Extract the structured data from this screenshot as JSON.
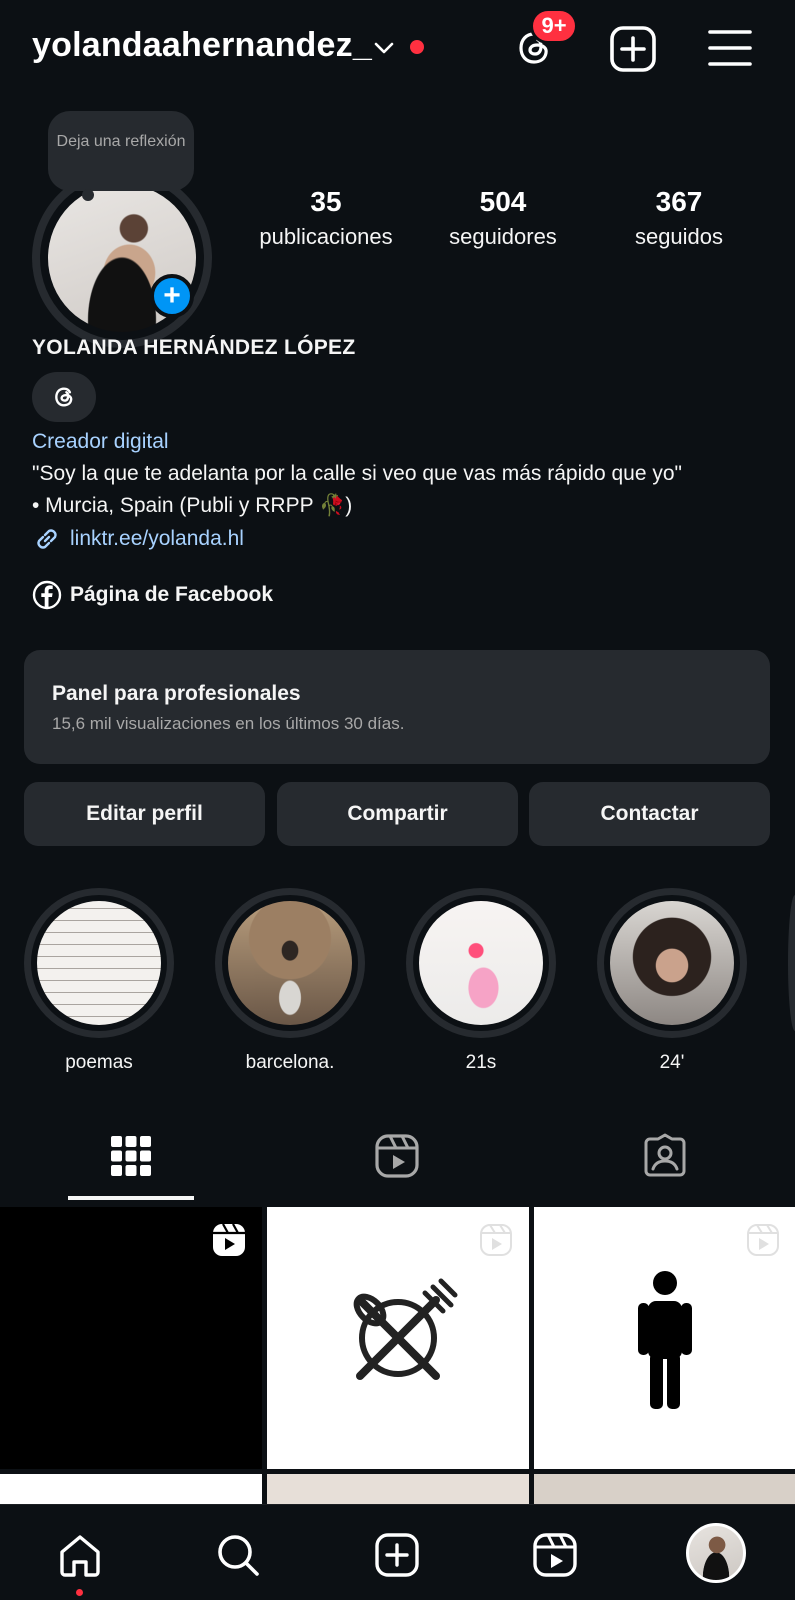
{
  "header": {
    "username": "yolandaahernandez_",
    "notification_badge": "9+"
  },
  "profile": {
    "note": "Deja una reflexión",
    "stats": [
      {
        "value": "35",
        "label": "publicaciones"
      },
      {
        "value": "504",
        "label": "seguidores"
      },
      {
        "value": "367",
        "label": "seguidos"
      }
    ],
    "full_name": "YOLANDA HERNÁNDEZ LÓPEZ",
    "category": "Creador digital",
    "bio_line1": "\"Soy la que te adelanta por la calle si veo que vas más rápido que yo\"",
    "bio_line2": "• Murcia, Spain (Publi y RRPP 🥀)",
    "link": "linktr.ee/yolanda.hl",
    "facebook": "Página de Facebook"
  },
  "dashboard": {
    "title": "Panel para profesionales",
    "subtitle": "15,6 mil visualizaciones en los últimos 30 días."
  },
  "actions": {
    "edit": "Editar perfil",
    "share": "Compartir",
    "contact": "Contactar"
  },
  "highlights": [
    {
      "label": "poemas"
    },
    {
      "label": "barcelona."
    },
    {
      "label": "21s"
    },
    {
      "label": "24'"
    }
  ],
  "tabs": [
    "grid-icon",
    "reels-icon",
    "tagged-icon"
  ],
  "nav": [
    "home-icon",
    "search-icon",
    "create-icon",
    "reels-icon",
    "profile-avatar"
  ],
  "colors": {
    "background": "#0c1014",
    "surface": "#262a2f",
    "accent_blue": "#0095f6",
    "link_blue": "#a8d2ff",
    "notification_red": "#ff3040"
  }
}
